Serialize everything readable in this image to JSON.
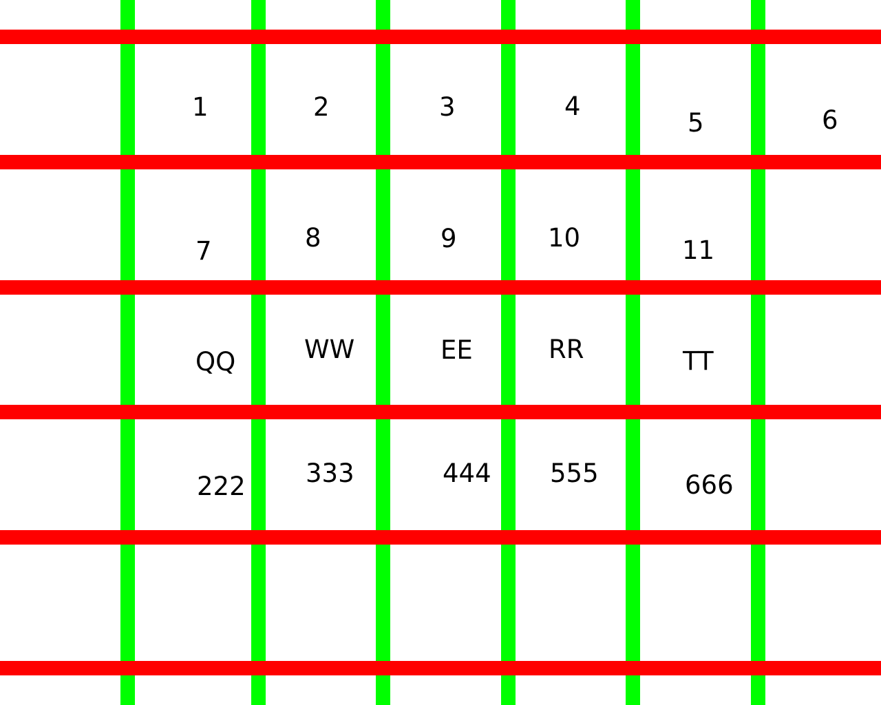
{
  "colors": {
    "background": "#ffffff",
    "vertical_lines": "#00ff00",
    "horizontal_lines": "#ff0000",
    "text": "#000000"
  },
  "rows": [
    [
      "1",
      "2",
      "3",
      "4",
      "5",
      "6"
    ],
    [
      "7",
      "8",
      "9",
      "10",
      "11"
    ],
    [
      "QQ",
      "WW",
      "EE",
      "RR",
      "TT"
    ],
    [
      "222",
      "333",
      "444",
      "555",
      "666"
    ]
  ]
}
